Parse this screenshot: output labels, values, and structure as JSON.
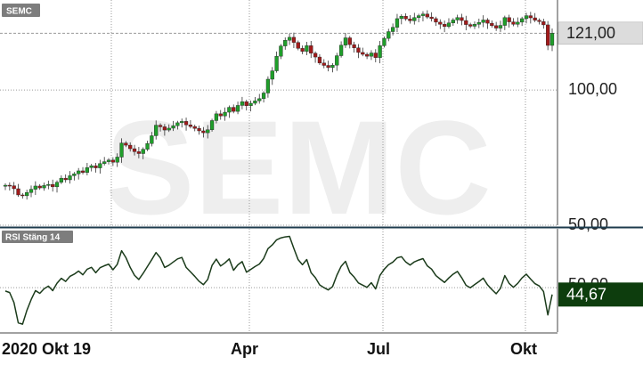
{
  "chart_data": [
    {
      "type": "candlestick",
      "ticker_label": "SEMC",
      "watermark": "SEMC",
      "y_ticks": [
        100,
        50
      ],
      "y_tick_labels": [
        "100,00",
        "50,00"
      ],
      "ylim": [
        50,
        130
      ],
      "last_price": 121.0,
      "last_price_label": "121,00",
      "x_labels": [
        "2020 Okt 19",
        "Apr",
        "Jul",
        "Okt"
      ],
      "colors": {
        "up": "#1f9e2a",
        "down": "#a11a1a",
        "last_price_box": "#dcdcdc"
      },
      "grid": true,
      "grid_style": "dotted",
      "closes": [
        64.8,
        64.6,
        63.5,
        61.2,
        60.9,
        62.1,
        63.3,
        64.5,
        63.8,
        64.7,
        65.1,
        64.2,
        65.9,
        67.4,
        66.8,
        68.3,
        69.0,
        70.1,
        69.5,
        71.3,
        72.0,
        71.2,
        72.8,
        73.5,
        74.1,
        73.3,
        75.2,
        80.4,
        79.6,
        78.3,
        77.2,
        76.5,
        78.1,
        80.2,
        83.1,
        87.0,
        86.4,
        85.2,
        85.9,
        86.8,
        87.9,
        88.4,
        87.1,
        86.5,
        85.8,
        84.9,
        84.2,
        85.3,
        88.7,
        91.2,
        90.4,
        91.8,
        93.6,
        92.1,
        94.3,
        95.7,
        94.2,
        95.1,
        96.0,
        96.8,
        98.9,
        104.0,
        107.1,
        112.5,
        116.3,
        118.4,
        119.5,
        117.6,
        115.4,
        114.3,
        116.4,
        113.6,
        112.2,
        110.0,
        109.1,
        108.3,
        109.2,
        112.7,
        116.6,
        119.3,
        116.8,
        115.6,
        113.9,
        113.2,
        112.5,
        113.7,
        112.0,
        116.4,
        119.1,
        121.6,
        123.2,
        126.4,
        127.3,
        126.3,
        125.6,
        126.8,
        127.5,
        128.1,
        127.0,
        126.4,
        125.1,
        124.3,
        123.5,
        124.8,
        125.9,
        126.8,
        125.7,
        124.2,
        123.6,
        124.3,
        125.0,
        125.9,
        124.7,
        123.8,
        122.9,
        123.9,
        126.8,
        125.2,
        124.3,
        125.1,
        126.4,
        127.5,
        126.7,
        125.8,
        125.3,
        124.1,
        116.5,
        121.0
      ]
    },
    {
      "type": "line",
      "label": "RSI Stäng 14",
      "y_ticks": [
        50
      ],
      "y_tick_labels": [
        "50,00"
      ],
      "ylim": [
        15,
        92
      ],
      "last_value": 44.67,
      "last_value_label": "44,67",
      "colors": {
        "line": "#1b3b1b",
        "value_box": "#0d3d0d"
      },
      "values": [
        47.4,
        46.2,
        38.5,
        22.8,
        21.8,
        32.4,
        40.8,
        47.7,
        45.6,
        49.1,
        51.2,
        47.7,
        53.4,
        57.2,
        54.8,
        58.7,
        60.4,
        62.8,
        59.9,
        64.2,
        65.7,
        61.5,
        65.4,
        66.9,
        68.1,
        63.8,
        68.0,
        78.5,
        73.2,
        65.6,
        59.5,
        56.3,
        61.0,
        66.3,
        71.6,
        77.1,
        73.0,
        65.6,
        67.3,
        69.8,
        72.2,
        73.3,
        65.6,
        62.2,
        58.7,
        54.9,
        52.3,
        56.3,
        67.1,
        72.0,
        66.7,
        69.1,
        72.2,
        63.4,
        67.6,
        70.1,
        61.9,
        64.1,
        66.3,
        68.2,
        72.5,
        80.1,
        83.0,
        86.9,
        88.4,
        89.2,
        89.6,
        80.3,
        71.6,
        67.7,
        71.7,
        61.6,
        57.7,
        52.1,
        50.0,
        48.2,
        50.8,
        59.6,
        66.5,
        70.3,
        61.7,
        58.2,
        53.6,
        51.9,
        50.2,
        53.8,
        49.0,
        59.4,
        64.2,
        67.7,
        69.7,
        73.0,
        73.9,
        69.8,
        67.4,
        69.9,
        71.3,
        72.4,
        66.8,
        64.3,
        59.3,
        56.6,
        54.0,
        57.5,
        60.4,
        62.5,
        57.6,
        51.8,
        49.9,
        52.4,
        54.7,
        57.3,
        52.1,
        48.5,
        45.3,
        49.5,
        59.3,
        53.3,
        50.3,
        53.3,
        57.5,
        60.4,
        56.6,
        53.1,
        51.3,
        47.0,
        28.9,
        44.67
      ]
    }
  ]
}
